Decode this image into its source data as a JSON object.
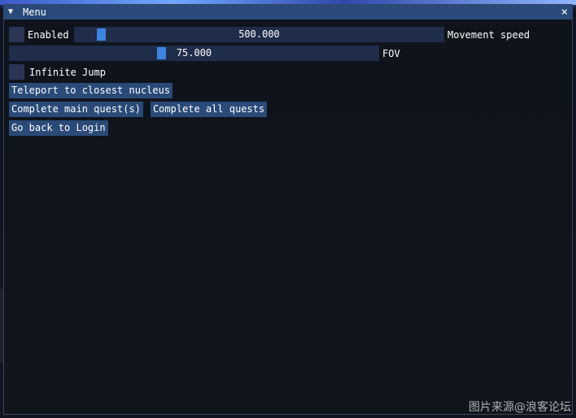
{
  "window": {
    "title": "Menu",
    "collapse_icon": "triangle-down-icon",
    "close_label": "×"
  },
  "controls": {
    "enabled": {
      "label": "Enabled",
      "checked": false
    },
    "movement_speed": {
      "value_text": "500.000",
      "label": "Movement speed",
      "fraction": 0.06
    },
    "fov": {
      "value_text": "75.000",
      "label": "FOV",
      "fraction": 0.41
    },
    "infinite_jump": {
      "label": "Infinite Jump",
      "checked": false
    }
  },
  "buttons": {
    "teleport": "Teleport to closest nucleus",
    "complete_main": "Complete main quest(s)",
    "complete_all": "Complete all quests",
    "go_back": "Go back to Login"
  },
  "watermark": "图片来源@浪客论坛",
  "colors": {
    "title_bar": "#294a7a",
    "frame_bg": "#1f2d4a",
    "checkbox_bg": "#293552",
    "slider_grab": "#3d85e0",
    "button_bg": "#2a4a78"
  }
}
